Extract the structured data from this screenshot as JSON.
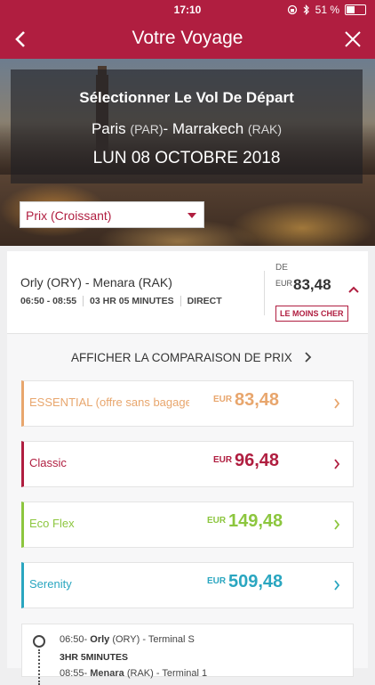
{
  "status_bar": {
    "time": "17:10",
    "battery_text": "51 %",
    "battery_level": 0.51
  },
  "nav": {
    "title": "Votre Voyage"
  },
  "hero": {
    "heading": "Sélectionner Le Vol De Départ",
    "origin_city": "Paris",
    "origin_code": "(PAR)",
    "separator": "- ",
    "destination_city": "Marrakech",
    "destination_code": "(RAK)",
    "date": "LUN 08 OCTOBRE 2018"
  },
  "sort": {
    "selected": "Prix (Croissant)"
  },
  "flight": {
    "route": "Orly (ORY) - Menara (RAK)",
    "times": "06:50 - 08:55",
    "duration": "03 HR 05 MINUTES",
    "type": "DIRECT",
    "from_label": "DE",
    "currency": "EUR",
    "price": "83,48",
    "badge": "LE MOINS CHER"
  },
  "compare": {
    "label": "AFFICHER LA COMPARAISON DE PRIX"
  },
  "fares": [
    {
      "name": "ESSENTIAL (offre sans bagages)",
      "currency": "EUR",
      "amount": "83,48",
      "color": "#e8a66d"
    },
    {
      "name": "Classic",
      "currency": "EUR",
      "amount": "96,48",
      "color": "#b01e40"
    },
    {
      "name": "Eco Flex",
      "currency": "EUR",
      "amount": "149,48",
      "color": "#8cc63e"
    },
    {
      "name": "Serenity",
      "currency": "EUR",
      "amount": "509,48",
      "color": "#2aa6c0"
    }
  ],
  "segment": {
    "dep_time": "06:50-",
    "dep_airport": "Orly",
    "dep_rest": " (ORY) - Terminal S",
    "duration": "3HR 5MINUTES",
    "arr_time": "08:55-",
    "arr_airport": "Menara",
    "arr_rest": " (RAK) - Terminal 1"
  },
  "colors": {
    "brand": "#b01e40"
  }
}
